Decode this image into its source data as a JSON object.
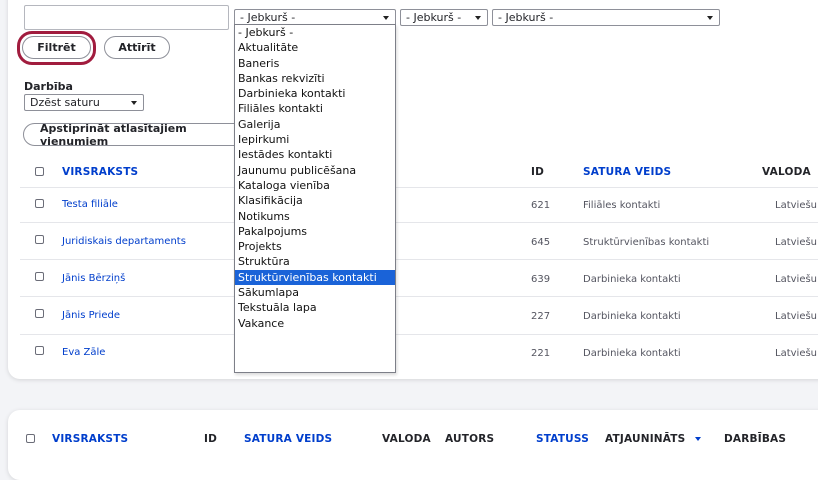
{
  "filters": {
    "title_value": "",
    "type_select": "- Jebkurš -",
    "status_select": "- Jebkurš -",
    "lang_select": "- Jebkurš -",
    "filter_button": "Filtrēt",
    "reset_button": "Attīrīt"
  },
  "action": {
    "label": "Darbība",
    "select": "Dzēst saturu",
    "apply_button": "Apstiprināt atlasītajiem vienumiem"
  },
  "table": {
    "headers": {
      "title": "VIRSRAKSTS",
      "id": "ID",
      "type": "SATURA VEIDS",
      "lang": "VALODA"
    },
    "rows": [
      {
        "title": "Testa filiāle",
        "id": "621",
        "type": "Filiāles kontakti",
        "lang": "Latviešu"
      },
      {
        "title": "Juridiskais departaments",
        "id": "645",
        "type": "Struktūrvienības kontakti",
        "lang": "Latviešu"
      },
      {
        "title": "Jānis Bērziņš",
        "id": "639",
        "type": "Darbinieka kontakti",
        "lang": "Latviešu"
      },
      {
        "title": "Jānis Priede",
        "id": "227",
        "type": "Darbinieka kontakti",
        "lang": "Latviešu"
      },
      {
        "title": "Eva Zāle",
        "id": "221",
        "type": "Darbinieka kontakti",
        "lang": "Latviešu"
      }
    ]
  },
  "dropdown": {
    "options": [
      "- Jebkurš -",
      "Aktualitāte",
      "Baneris",
      "Bankas rekvizīti",
      "Darbinieka kontakti",
      "Filiāles kontakti",
      "Galerija",
      "Iepirkumi",
      "Iestādes kontakti",
      "Jaunumu publicēšana",
      "Kataloga vienība",
      "Klasifikācija",
      "Notikums",
      "Pakalpojums",
      "Projekts",
      "Struktūra",
      "Struktūrvienības kontakti",
      "Sākumlapa",
      "Tekstuāla lapa",
      "Vakance"
    ],
    "selected_index": 16
  },
  "table2": {
    "headers": {
      "title": "VIRSRAKSTS",
      "id": "ID",
      "type": "SATURA VEIDS",
      "lang": "VALODA",
      "author": "AUTORS",
      "status": "STATUSS",
      "updated": "ATJAUNINĀTS",
      "ops": "DARBĪBAS"
    }
  },
  "colors": {
    "link": "#003ecc",
    "focus": "#a11c3e",
    "selected": "#1a63d8"
  }
}
